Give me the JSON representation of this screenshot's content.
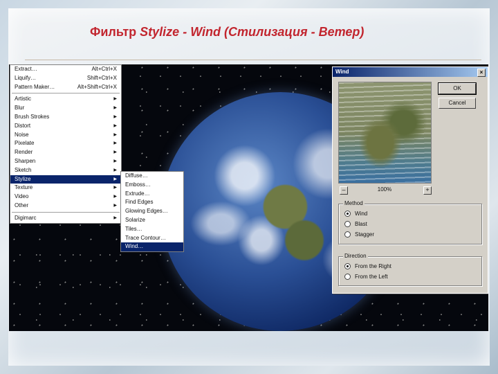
{
  "slide": {
    "title_prefix": "Фильтр ",
    "title_em": "Stylize - Wind (Стилизация - Ветер)"
  },
  "filter_menu": {
    "top_items": [
      {
        "label": "Extract…",
        "shortcut": "Alt+Ctrl+X"
      },
      {
        "label": "Liquify…",
        "shortcut": "Shift+Ctrl+X"
      },
      {
        "label": "Pattern Maker…",
        "shortcut": "Alt+Shift+Ctrl+X"
      }
    ],
    "items": [
      "Artistic",
      "Blur",
      "Brush Strokes",
      "Distort",
      "Noise",
      "Pixelate",
      "Render",
      "Sharpen",
      "Sketch",
      "Stylize",
      "Texture",
      "Video",
      "Other"
    ],
    "selected": "Stylize",
    "bottom_items": [
      "Digimarc"
    ]
  },
  "stylize_submenu": {
    "items": [
      "Diffuse…",
      "Emboss…",
      "Extrude…",
      "Find Edges",
      "Glowing Edges…",
      "Solarize",
      "Tiles…",
      "Trace Contour…",
      "Wind…"
    ],
    "selected": "Wind…"
  },
  "wind_dialog": {
    "title": "Wind",
    "close_glyph": "×",
    "ok_label": "OK",
    "cancel_label": "Cancel",
    "zoom_out": "–",
    "zoom_in": "+",
    "zoom_level": "100%",
    "method_label": "Method",
    "method_options": [
      "Wind",
      "Blast",
      "Stagger"
    ],
    "method_selected": "Wind",
    "direction_label": "Direction",
    "direction_options": [
      "From the Right",
      "From the Left"
    ],
    "direction_selected": "From the Right"
  },
  "colors": {
    "title_red": "#c2252e",
    "menu_highlight": "#0a246a",
    "dialog_bg": "#d4d0c8"
  },
  "icons": [
    "close-icon",
    "submenu-arrow-icon",
    "zoom-out-icon",
    "zoom-in-icon"
  ]
}
